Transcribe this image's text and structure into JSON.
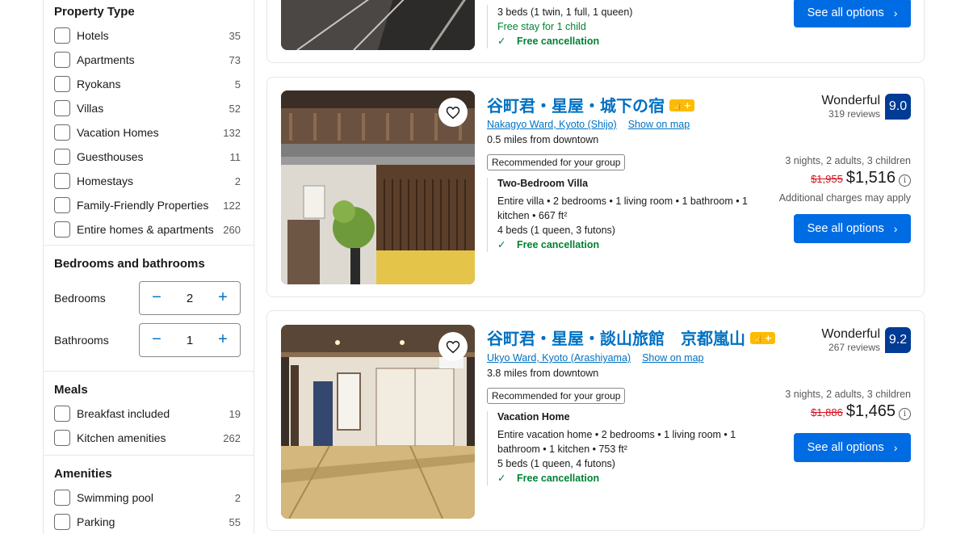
{
  "filters": {
    "property_type": {
      "title": "Property Type",
      "items": [
        {
          "label": "Hotels",
          "count": "35"
        },
        {
          "label": "Apartments",
          "count": "73"
        },
        {
          "label": "Ryokans",
          "count": "5"
        },
        {
          "label": "Villas",
          "count": "52"
        },
        {
          "label": "Vacation Homes",
          "count": "132"
        },
        {
          "label": "Guesthouses",
          "count": "11"
        },
        {
          "label": "Homestays",
          "count": "2"
        },
        {
          "label": "Family-Friendly Properties",
          "count": "122"
        },
        {
          "label": "Entire homes & apartments",
          "count": "260"
        }
      ]
    },
    "bedrooms_bathrooms": {
      "title": "Bedrooms and bathrooms",
      "bedrooms_label": "Bedrooms",
      "bedrooms_value": "2",
      "bathrooms_label": "Bathrooms",
      "bathrooms_value": "1",
      "minus": "−",
      "plus": "+"
    },
    "meals": {
      "title": "Meals",
      "items": [
        {
          "label": "Breakfast included",
          "count": "19"
        },
        {
          "label": "Kitchen amenities",
          "count": "262"
        }
      ]
    },
    "amenities": {
      "title": "Amenities",
      "items": [
        {
          "label": "Swimming pool",
          "count": "2"
        },
        {
          "label": "Parking",
          "count": "55"
        }
      ]
    }
  },
  "card0": {
    "beds": "3 beds (1 twin, 1 full, 1 queen)",
    "child": "Free stay for 1 child",
    "free_cancel": "Free cancellation",
    "cta": "See all options"
  },
  "card1": {
    "title": "谷町君・星屋・城下の宿",
    "badge": "👍+",
    "area": "Nakagyo Ward, Kyoto (Shijo)",
    "map": "Show on map",
    "distance": "0.5 miles from downtown",
    "recommended": "Recommended for your group",
    "unit_name": "Two-Bedroom Villa",
    "unit_desc": "Entire villa • 2 bedrooms • 1 living room • 1 bathroom • 1 kitchen • 667 ft²",
    "beds": "4 beds (1 queen, 3 futons)",
    "free_cancel": "Free cancellation",
    "score_word": "Wonderful",
    "reviews": "319 reviews",
    "score": "9.0",
    "stay": "3 nights, 2 adults, 3 children",
    "old_price": "$1,955",
    "price": "$1,516",
    "additional": "Additional charges may apply",
    "cta": "See all options"
  },
  "card2": {
    "title": "谷町君・星屋・談山旅館　京都嵐山",
    "badge": "👍+",
    "area": "Ukyo Ward, Kyoto (Arashiyama)",
    "map": "Show on map",
    "distance": "3.8 miles from downtown",
    "recommended": "Recommended for your group",
    "unit_name": "Vacation Home",
    "unit_desc": "Entire vacation home • 2 bedrooms • 1 living room • 1 bathroom • 1 kitchen • 753 ft²",
    "beds": "5 beds (1 queen, 4 futons)",
    "free_cancel": "Free cancellation",
    "score_word": "Wonderful",
    "reviews": "267 reviews",
    "score": "9.2",
    "stay": "3 nights, 2 adults, 3 children",
    "old_price": "$1,886",
    "price": "$1,465",
    "cta": "See all options"
  },
  "icons": {
    "check": "✓",
    "chevron": "›",
    "info": "i"
  },
  "colors": {
    "link": "#0071c2",
    "cta": "#006ce4",
    "score": "#003b95",
    "green": "#008234",
    "strike": "#d4111e",
    "genius": "#febb02"
  }
}
